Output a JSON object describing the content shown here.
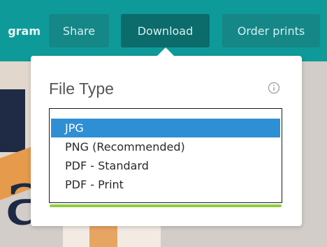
{
  "toolbar": {
    "brand_fragment": "gram",
    "share_label": "Share",
    "download_label": "Download",
    "order_prints_label": "Order prints",
    "colors": {
      "bar": "#0f9a9a",
      "button": "#158787",
      "active_button": "#0c6b6b"
    }
  },
  "download_panel": {
    "title": "File Type",
    "info_icon": "info-circle-icon",
    "file_type_select": {
      "selected": "JPG",
      "options": [
        "JPG",
        "PNG (Recommended)",
        "PDF - Standard",
        "PDF - Print"
      ],
      "highlight_color": "#2f8fd4",
      "accent_color": "#8fcd3e"
    }
  }
}
